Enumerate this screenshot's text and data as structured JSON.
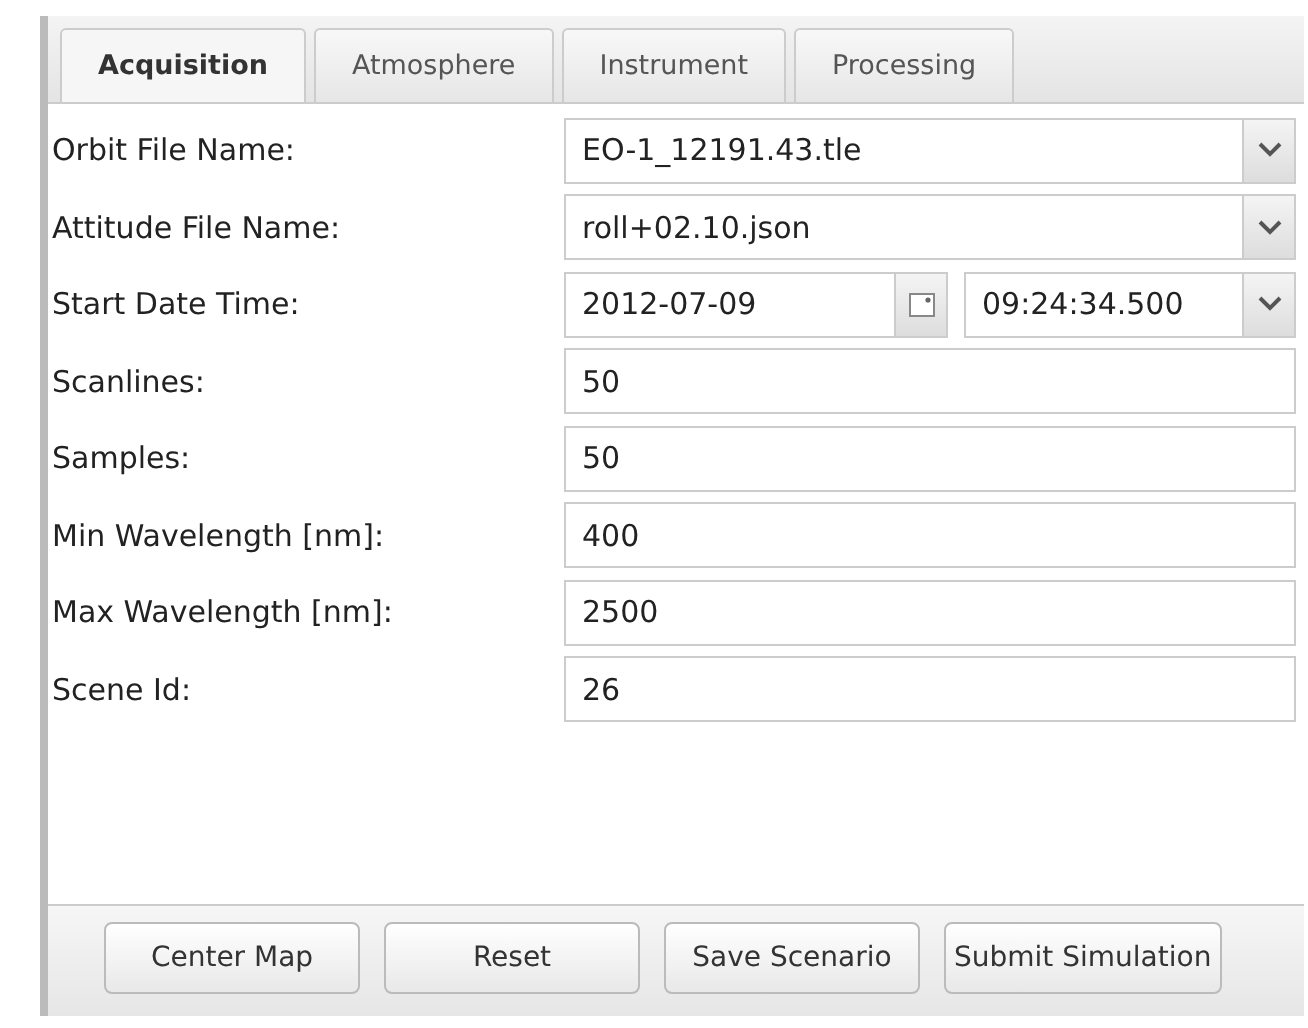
{
  "tabs": [
    {
      "label": "Acquisition",
      "selected": true
    },
    {
      "label": "Atmosphere",
      "selected": false
    },
    {
      "label": "Instrument",
      "selected": false
    },
    {
      "label": "Processing",
      "selected": false
    }
  ],
  "fields": [
    {
      "label": "Orbit File Name:",
      "kind": "select",
      "value": "EO-1_12191.43.tle"
    },
    {
      "label": "Attitude File Name:",
      "kind": "select",
      "value": "roll+02.10.json"
    },
    {
      "label": "Start Date Time:",
      "kind": "datetime",
      "date": "2012-07-09",
      "time": "09:24:34.500"
    },
    {
      "label": "Scanlines:",
      "kind": "text",
      "value": "50"
    },
    {
      "label": "Samples:",
      "kind": "text",
      "value": "50"
    },
    {
      "label": "Min Wavelength [nm]:",
      "kind": "text",
      "value": "400"
    },
    {
      "label": "Max Wavelength [nm]:",
      "kind": "text",
      "value": "2500"
    },
    {
      "label": "Scene Id:",
      "kind": "text",
      "value": "26"
    }
  ],
  "buttons": [
    "Center Map",
    "Reset",
    "Save Scenario",
    "Submit Simulation"
  ]
}
